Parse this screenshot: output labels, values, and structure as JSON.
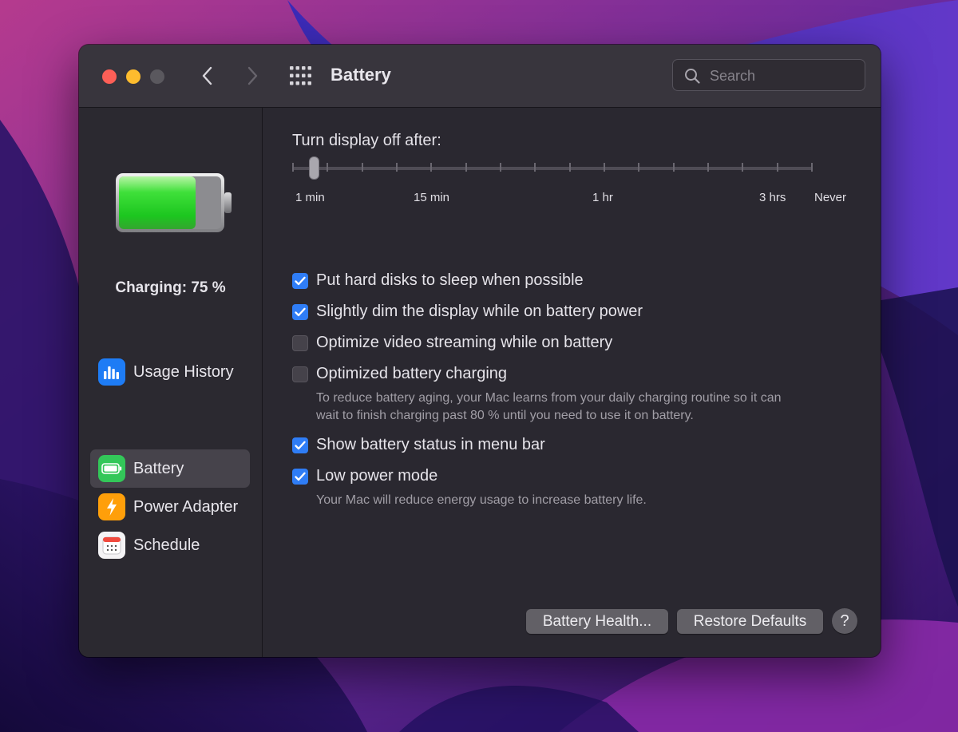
{
  "window": {
    "title": "Battery",
    "search_placeholder": "Search"
  },
  "sidebar": {
    "battery_status": "Charging: 75 %",
    "charge_level": 0.75,
    "items": [
      {
        "label": "Usage History",
        "icon": "bar-chart-icon",
        "color": "#1e7cf5",
        "active": false
      },
      {
        "label": "Battery",
        "icon": "battery-icon",
        "color": "#33c759",
        "active": true
      },
      {
        "label": "Power Adapter",
        "icon": "lightning-icon",
        "color": "#ff9f0a",
        "active": false
      },
      {
        "label": "Schedule",
        "icon": "calendar-icon",
        "color": "#ffffff",
        "active": false
      }
    ]
  },
  "display_slider": {
    "label": "Turn display off after:",
    "tick_labels": [
      "1 min",
      "15 min",
      "1 hr",
      "3 hrs",
      "Never"
    ],
    "value": "1 min"
  },
  "options": [
    {
      "label": "Put hard disks to sleep when possible",
      "checked": true
    },
    {
      "label": "Slightly dim the display while on battery power",
      "checked": true
    },
    {
      "label": "Optimize video streaming while on battery",
      "checked": false
    },
    {
      "label": "Optimized battery charging",
      "checked": false,
      "description_lines": [
        "To reduce battery aging, your Mac learns from your daily charging routine so it can",
        "wait to finish charging past 80 % until you need to use it on battery."
      ]
    },
    {
      "label": "Show battery status in menu bar",
      "checked": true
    },
    {
      "label": "Low power mode",
      "checked": true,
      "description_lines": [
        "Your Mac will reduce energy usage to increase battery life."
      ]
    }
  ],
  "buttons": {
    "battery_health": "Battery Health...",
    "restore_defaults": "Restore Defaults",
    "help": "?"
  },
  "colors": {
    "accent": "#2f7df6",
    "battery_fill": "#27d42b"
  }
}
